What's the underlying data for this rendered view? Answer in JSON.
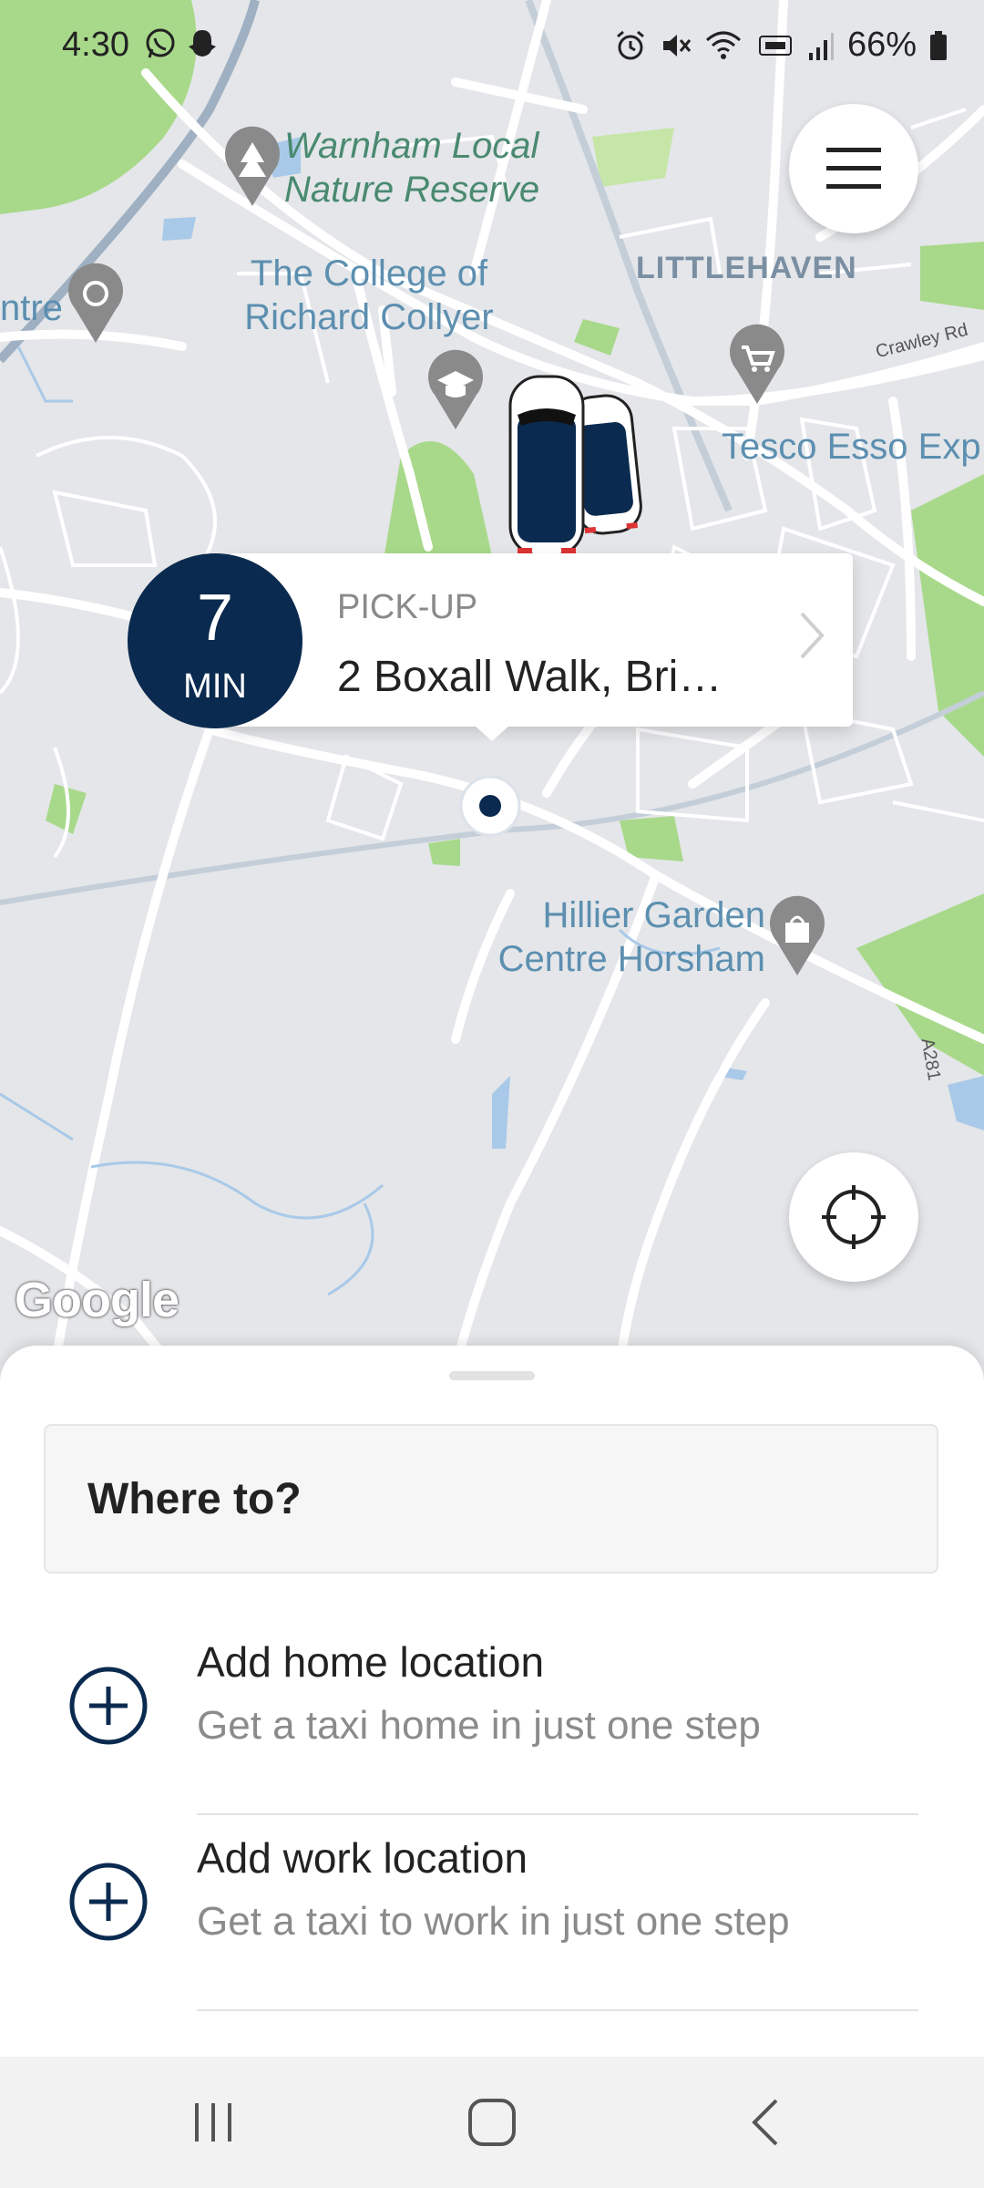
{
  "status_bar": {
    "time": "4:30",
    "battery": "66%"
  },
  "map": {
    "places": {
      "warnham": "Warnham Local Nature Reserve",
      "college": "The College of Richard Collyer",
      "littlehaven": "LITTLEHAVEN",
      "crawley_rd": "Crawley Rd",
      "tesco": "Tesco Esso Exp",
      "hillier": "Hillier Garden Centre Horsham",
      "a281": "A281",
      "centre_partial": "ntre"
    },
    "attribution": "Google"
  },
  "pickup": {
    "eta_value": "7",
    "eta_unit": "MIN",
    "label": "PICK-UP",
    "address": "2 Boxall Walk, Bri…"
  },
  "sheet": {
    "search_placeholder": "Where to?",
    "items": [
      {
        "title": "Add home location",
        "subtitle": "Get a taxi home in just one step"
      },
      {
        "title": "Add work location",
        "subtitle": "Get a taxi to work in just one step"
      }
    ]
  },
  "colors": {
    "brand_navy": "#0b2a4f",
    "map_bg": "#e4e6e9",
    "park_green": "#a8d98a",
    "water_blue": "#a9c9e8"
  }
}
